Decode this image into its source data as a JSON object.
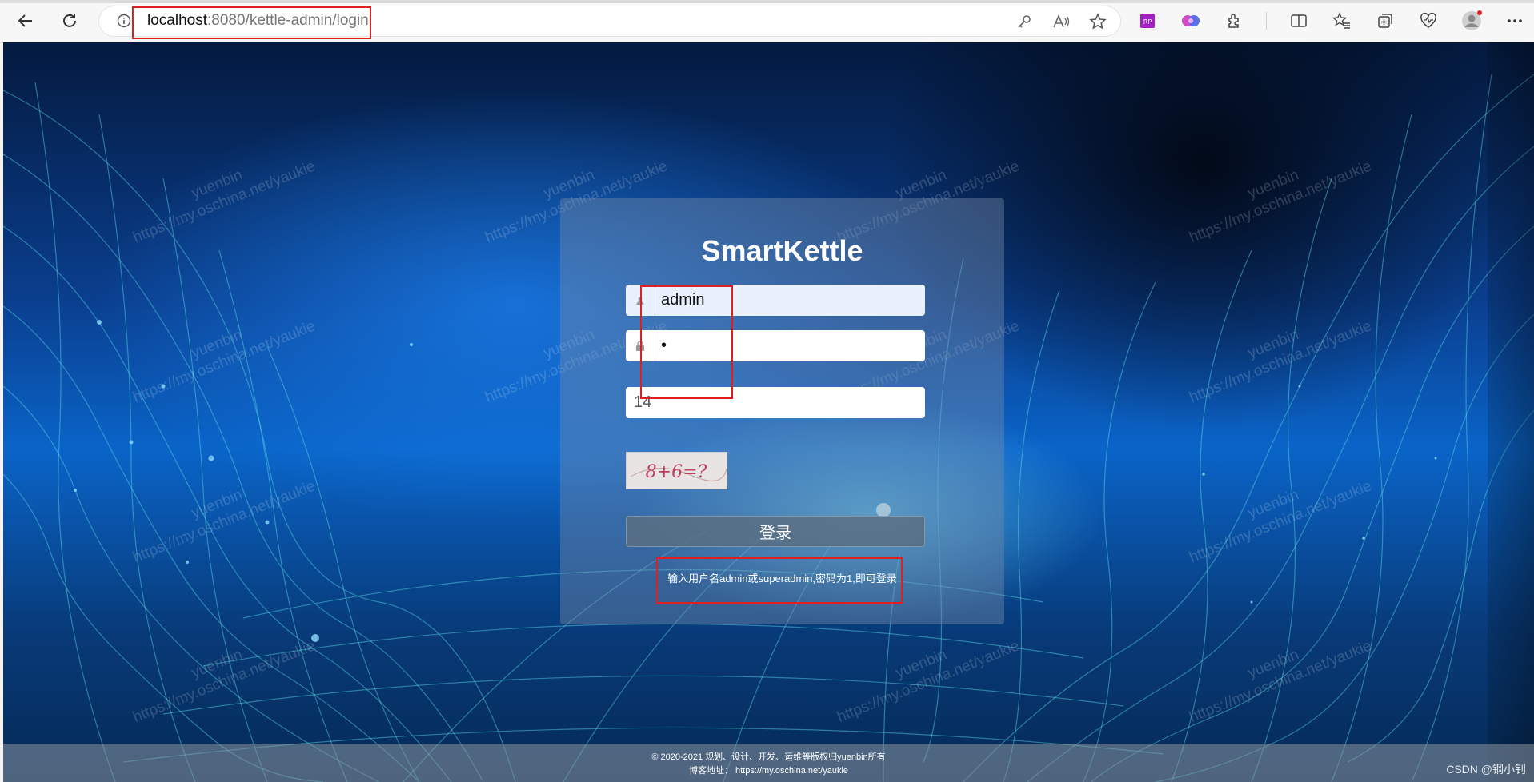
{
  "browser": {
    "url_host": "localhost",
    "url_rest": ":8080/kettle-admin/login",
    "icons": [
      "back-icon",
      "refresh-icon",
      "info-icon",
      "key-icon",
      "read-aloud-icon",
      "favorite-star-icon",
      "extension-rp-icon",
      "extension-brain-icon",
      "extensions-icon",
      "split-screen-icon",
      "favorites-icon",
      "collections-icon",
      "performance-icon",
      "profile-avatar-icon",
      "more-icon"
    ]
  },
  "login": {
    "brand": "SmartKettle",
    "username": "admin",
    "password": "•",
    "captcha_value": "14",
    "captcha_text": "8+6=?",
    "submit_label": "登录",
    "hint": "输入用户名admin或superadmin,密码为1,即可登录"
  },
  "watermark": {
    "name": "yuenbin",
    "url": "https://my.oschina.net/yaukie"
  },
  "footer": {
    "copyright": "© 2020-2021 规划、设计、开发、运维等版权归yuenbin所有",
    "blog": "博客地址： https://my.oschina.net/yaukie"
  },
  "csdn_tag": "CSDN @钢小钊",
  "colors": {
    "annotation": "#e02020",
    "card": "rgba(120,140,170,0.42)",
    "field_filled": "#e9f0fe"
  }
}
